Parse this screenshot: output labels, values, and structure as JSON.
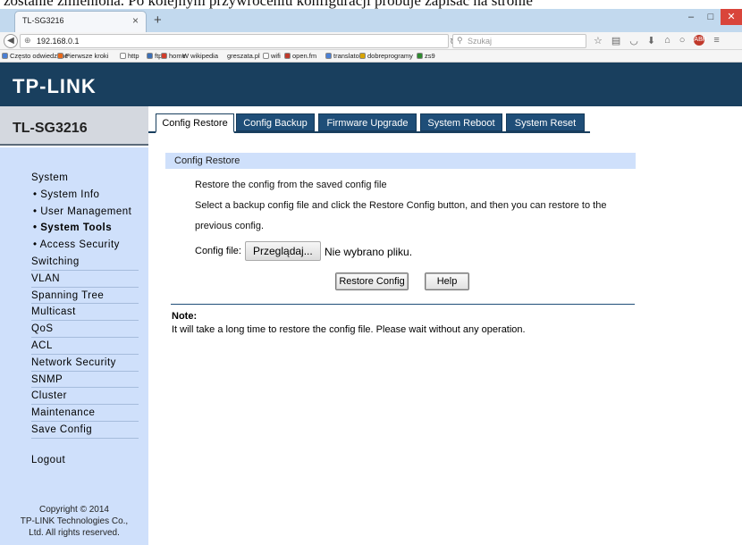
{
  "doc_strip_text": "zostanie zmieniona. Po kolejnym przywróceniu konfiguracji próbuje zapisać na stronie",
  "browser": {
    "tab_title": "TL-SG3216",
    "tab_close": "×",
    "new_tab": "+",
    "url": "192.168.0.1",
    "search_placeholder": "Szukaj",
    "window_controls": [
      "–",
      "□",
      "✕"
    ],
    "bookmarks": [
      {
        "label": "Często odwiedzane",
        "color": "#4a7fd4"
      },
      {
        "label": "Pierwsze kroki",
        "color": "#e8691b"
      },
      {
        "label": "http",
        "color": "#ffffff"
      },
      {
        "label": "ftp",
        "color": "#3b6fb6"
      },
      {
        "label": "home",
        "color": "#d13d2b"
      },
      {
        "label": "W wikipedia",
        "color": ""
      },
      {
        "label": "greszata.pl",
        "color": ""
      },
      {
        "label": "wifi",
        "color": "#ffffff"
      },
      {
        "label": "open.fm",
        "color": "#c0392b"
      },
      {
        "label": "translator",
        "color": "#4a7fd4"
      },
      {
        "label": "dobreprogramy",
        "color": "#d8a400"
      },
      {
        "label": "zs9",
        "color": "#2e8b2e"
      }
    ]
  },
  "header": {
    "logo": "TP-LINK",
    "model": "TL-SG3216"
  },
  "tabs": [
    {
      "label": "Config Restore",
      "active": true
    },
    {
      "label": "Config Backup",
      "active": false
    },
    {
      "label": "Firmware Upgrade",
      "active": false
    },
    {
      "label": "System Reboot",
      "active": false
    },
    {
      "label": "System Reset",
      "active": false
    }
  ],
  "sidebar": {
    "items": [
      {
        "label": "System",
        "sub": false,
        "line": false
      },
      {
        "label": "• System Info",
        "sub": true,
        "line": false
      },
      {
        "label": "• User Management",
        "sub": true,
        "line": false
      },
      {
        "label": "• System Tools",
        "sub": true,
        "line": false,
        "active": true
      },
      {
        "label": "• Access Security",
        "sub": true,
        "line": false
      },
      {
        "label": "Switching",
        "sub": false,
        "line": true
      },
      {
        "label": "VLAN",
        "sub": false,
        "line": true
      },
      {
        "label": "Spanning Tree",
        "sub": false,
        "line": true
      },
      {
        "label": "Multicast",
        "sub": false,
        "line": true
      },
      {
        "label": "QoS",
        "sub": false,
        "line": true
      },
      {
        "label": "ACL",
        "sub": false,
        "line": true
      },
      {
        "label": "Network Security",
        "sub": false,
        "line": true
      },
      {
        "label": "SNMP",
        "sub": false,
        "line": true
      },
      {
        "label": "Cluster",
        "sub": false,
        "line": true
      },
      {
        "label": "Maintenance",
        "sub": false,
        "line": true
      },
      {
        "label": "Save Config",
        "sub": false,
        "line": true
      }
    ],
    "logout": "Logout",
    "copyright": [
      "Copyright © 2014",
      "TP-LINK Technologies Co.,",
      "Ltd. All rights reserved."
    ]
  },
  "content": {
    "section_title": "Config Restore",
    "line1": "Restore the config from the saved config file",
    "line2": "Select a backup config file and click the Restore Config button, and then you can restore to the",
    "line3": "previous config.",
    "file_label": "Config file:",
    "browse_label": "Przeglądaj...",
    "no_file_text": "Nie wybrano pliku.",
    "restore_button": "Restore Config",
    "help_button": "Help",
    "note_title": "Note:",
    "note_text": "It will take a long time to restore the config file. Please wait without any operation."
  }
}
